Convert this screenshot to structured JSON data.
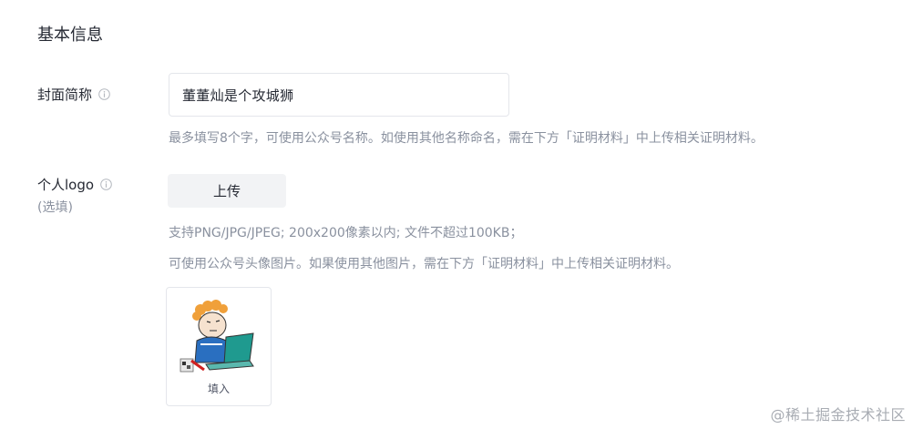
{
  "section": {
    "title": "基本信息"
  },
  "cover_name": {
    "label": "封面简称",
    "value": "董董灿是个攻城狮",
    "hint": "最多填写8个字，可使用公众号名称。如使用其他名称命名，需在下方「证明材料」中上传相关证明材料。"
  },
  "logo": {
    "label": "个人logo",
    "sub_label": "(选填)",
    "upload_label": "上传",
    "hint_line1": "支持PNG/JPG/JPEG; 200x200像素以内; 文件不超过100KB；",
    "hint_line2": "可使用公众号头像图片。如果使用其他图片，需在下方「证明材料」中上传相关证明材料。",
    "preview_caption": "填入"
  },
  "watermark": "@稀土掘金技术社区",
  "colors": {
    "text": "#252933",
    "muted": "#8a919f",
    "border": "#e4e6eb",
    "button_bg": "#f2f3f5"
  },
  "icons": {
    "info": "info-circle-icon"
  }
}
